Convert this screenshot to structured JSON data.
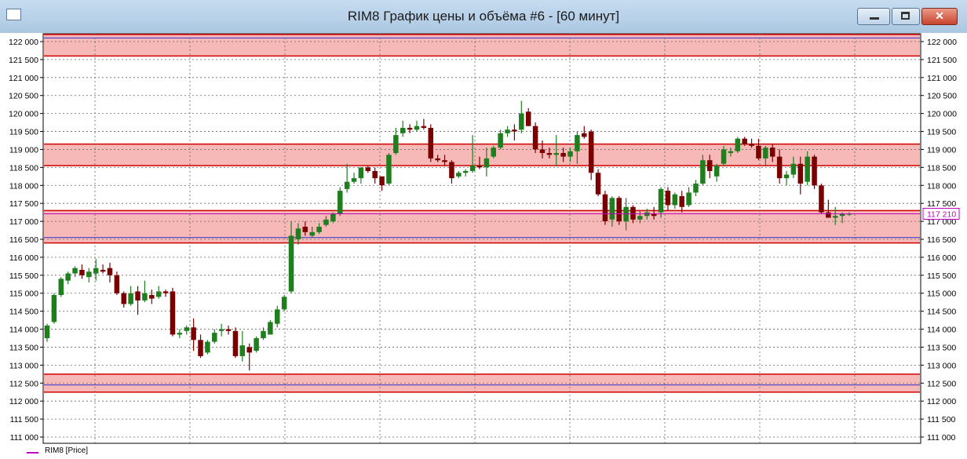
{
  "window": {
    "title": "RIM8 График цены и объёма #6 - [60 минут]",
    "buttons": {
      "minimize_glyph": "",
      "maximize_glyph": "",
      "close_glyph": "✕"
    }
  },
  "legend": {
    "series_label": "RIM8 [Price]"
  },
  "colors": {
    "bull": "#1f7f1f",
    "bear": "#7a0000",
    "zone_fill": "#f7b8b8",
    "zone_line": "#d00000",
    "blue_line": "#3030d0",
    "current_price": "#c000c0"
  },
  "chart_data": {
    "type": "candlestick",
    "title": "RIM8 График цены и объёма #6 - [60 минут]",
    "series_name": "RIM8 [Price]",
    "ylim": [
      111000,
      122200
    ],
    "y_ticks": [
      "122 000",
      "121 500",
      "121 000",
      "120 500",
      "120 000",
      "119 500",
      "119 000",
      "118 500",
      "118 000",
      "117 500",
      "117 000",
      "116 500",
      "116 000",
      "115 500",
      "115 000",
      "114 500",
      "114 000",
      "113 500",
      "113 000",
      "112 500",
      "112 000",
      "111 500",
      "111 000"
    ],
    "current_price_label": "117 210",
    "current_price": 117210,
    "grid": true,
    "zones": [
      {
        "low": 121600,
        "high": 122200,
        "blue": 122100
      },
      {
        "low": 118550,
        "high": 119150,
        "blue": null
      },
      {
        "low": 116400,
        "high": 117300,
        "blue": 116550
      },
      {
        "low": 112250,
        "high": 112750,
        "blue": 112450
      }
    ],
    "candles": [
      {
        "o": 113750,
        "h": 114150,
        "l": 113650,
        "c": 114100
      },
      {
        "o": 114200,
        "h": 115000,
        "l": 114150,
        "c": 114950
      },
      {
        "o": 114950,
        "h": 115450,
        "l": 114900,
        "c": 115400
      },
      {
        "o": 115350,
        "h": 115600,
        "l": 115250,
        "c": 115550
      },
      {
        "o": 115550,
        "h": 115750,
        "l": 115450,
        "c": 115700
      },
      {
        "o": 115650,
        "h": 115800,
        "l": 115400,
        "c": 115500
      },
      {
        "o": 115450,
        "h": 115700,
        "l": 115300,
        "c": 115600
      },
      {
        "o": 115550,
        "h": 115950,
        "l": 115350,
        "c": 115700
      },
      {
        "o": 115650,
        "h": 115800,
        "l": 115550,
        "c": 115600
      },
      {
        "o": 115700,
        "h": 115850,
        "l": 115300,
        "c": 115500
      },
      {
        "o": 115500,
        "h": 115600,
        "l": 114950,
        "c": 115000
      },
      {
        "o": 115000,
        "h": 115050,
        "l": 114600,
        "c": 114700
      },
      {
        "o": 114700,
        "h": 115200,
        "l": 114650,
        "c": 115000
      },
      {
        "o": 115050,
        "h": 115200,
        "l": 114400,
        "c": 114800
      },
      {
        "o": 114800,
        "h": 115350,
        "l": 114750,
        "c": 115000
      },
      {
        "o": 114950,
        "h": 115100,
        "l": 114700,
        "c": 114850
      },
      {
        "o": 114900,
        "h": 115200,
        "l": 114850,
        "c": 115050
      },
      {
        "o": 115050,
        "h": 115100,
        "l": 114900,
        "c": 115000
      },
      {
        "o": 115050,
        "h": 115150,
        "l": 113800,
        "c": 113850
      },
      {
        "o": 113850,
        "h": 114000,
        "l": 113750,
        "c": 113900
      },
      {
        "o": 113950,
        "h": 114100,
        "l": 113850,
        "c": 114050
      },
      {
        "o": 114050,
        "h": 114300,
        "l": 113400,
        "c": 113700
      },
      {
        "o": 113700,
        "h": 113850,
        "l": 113200,
        "c": 113250
      },
      {
        "o": 113350,
        "h": 113700,
        "l": 113300,
        "c": 113650
      },
      {
        "o": 113650,
        "h": 114000,
        "l": 113600,
        "c": 113900
      },
      {
        "o": 113950,
        "h": 114150,
        "l": 113800,
        "c": 114000
      },
      {
        "o": 114000,
        "h": 114100,
        "l": 113850,
        "c": 113950
      },
      {
        "o": 113950,
        "h": 114050,
        "l": 113200,
        "c": 113250
      },
      {
        "o": 113250,
        "h": 113950,
        "l": 113100,
        "c": 113550
      },
      {
        "o": 113500,
        "h": 113600,
        "l": 112850,
        "c": 113350
      },
      {
        "o": 113400,
        "h": 113800,
        "l": 113350,
        "c": 113750
      },
      {
        "o": 113750,
        "h": 114050,
        "l": 113700,
        "c": 113950
      },
      {
        "o": 113850,
        "h": 114250,
        "l": 113850,
        "c": 114200
      },
      {
        "o": 114150,
        "h": 114650,
        "l": 114050,
        "c": 114550
      },
      {
        "o": 114550,
        "h": 114950,
        "l": 114500,
        "c": 114900
      },
      {
        "o": 115050,
        "h": 117000,
        "l": 115000,
        "c": 116600
      },
      {
        "o": 116500,
        "h": 116950,
        "l": 116350,
        "c": 116800
      },
      {
        "o": 116850,
        "h": 117000,
        "l": 116600,
        "c": 116700
      },
      {
        "o": 116600,
        "h": 116850,
        "l": 116550,
        "c": 116700
      },
      {
        "o": 116700,
        "h": 116950,
        "l": 116650,
        "c": 116850
      },
      {
        "o": 116900,
        "h": 117150,
        "l": 116850,
        "c": 117050
      },
      {
        "o": 117000,
        "h": 117250,
        "l": 116950,
        "c": 117200
      },
      {
        "o": 117200,
        "h": 117950,
        "l": 117150,
        "c": 117850
      },
      {
        "o": 117900,
        "h": 118600,
        "l": 117800,
        "c": 118100
      },
      {
        "o": 118100,
        "h": 118350,
        "l": 118050,
        "c": 118200
      },
      {
        "o": 118200,
        "h": 118400,
        "l": 118050,
        "c": 118500
      },
      {
        "o": 118500,
        "h": 118550,
        "l": 118350,
        "c": 118400
      },
      {
        "o": 118400,
        "h": 118500,
        "l": 118050,
        "c": 118200
      },
      {
        "o": 118250,
        "h": 118250,
        "l": 117850,
        "c": 118000
      },
      {
        "o": 118050,
        "h": 118900,
        "l": 118000,
        "c": 118850
      },
      {
        "o": 118900,
        "h": 119600,
        "l": 118850,
        "c": 119400
      },
      {
        "o": 119450,
        "h": 119800,
        "l": 119350,
        "c": 119600
      },
      {
        "o": 119600,
        "h": 119700,
        "l": 119450,
        "c": 119550
      },
      {
        "o": 119550,
        "h": 119800,
        "l": 119500,
        "c": 119650
      },
      {
        "o": 119650,
        "h": 119850,
        "l": 119550,
        "c": 119600
      },
      {
        "o": 119600,
        "h": 119700,
        "l": 118650,
        "c": 118750
      },
      {
        "o": 118750,
        "h": 118850,
        "l": 118650,
        "c": 118700
      },
      {
        "o": 118700,
        "h": 118850,
        "l": 118550,
        "c": 118650
      },
      {
        "o": 118650,
        "h": 118700,
        "l": 118050,
        "c": 118200
      },
      {
        "o": 118250,
        "h": 118400,
        "l": 118200,
        "c": 118350
      },
      {
        "o": 118350,
        "h": 118450,
        "l": 118250,
        "c": 118400
      },
      {
        "o": 118400,
        "h": 119400,
        "l": 118350,
        "c": 118550
      },
      {
        "o": 118550,
        "h": 118800,
        "l": 118450,
        "c": 118500
      },
      {
        "o": 118500,
        "h": 119050,
        "l": 118250,
        "c": 118750
      },
      {
        "o": 118800,
        "h": 119100,
        "l": 118750,
        "c": 119050
      },
      {
        "o": 119050,
        "h": 119550,
        "l": 119000,
        "c": 119450
      },
      {
        "o": 119450,
        "h": 119650,
        "l": 119350,
        "c": 119550
      },
      {
        "o": 119550,
        "h": 119700,
        "l": 119250,
        "c": 119500
      },
      {
        "o": 119550,
        "h": 120350,
        "l": 119450,
        "c": 120000
      },
      {
        "o": 120050,
        "h": 120150,
        "l": 119650,
        "c": 119650
      },
      {
        "o": 119650,
        "h": 119750,
        "l": 118900,
        "c": 119000
      },
      {
        "o": 119000,
        "h": 119250,
        "l": 118750,
        "c": 118900
      },
      {
        "o": 118900,
        "h": 119050,
        "l": 118750,
        "c": 118850
      },
      {
        "o": 118850,
        "h": 119400,
        "l": 118550,
        "c": 118900
      },
      {
        "o": 118900,
        "h": 119050,
        "l": 118650,
        "c": 118800
      },
      {
        "o": 118800,
        "h": 119050,
        "l": 118650,
        "c": 118950
      },
      {
        "o": 118950,
        "h": 119500,
        "l": 118600,
        "c": 119400
      },
      {
        "o": 119450,
        "h": 119650,
        "l": 119300,
        "c": 119350
      },
      {
        "o": 119500,
        "h": 119550,
        "l": 118150,
        "c": 118350
      },
      {
        "o": 118350,
        "h": 118450,
        "l": 117700,
        "c": 117750
      },
      {
        "o": 117750,
        "h": 117850,
        "l": 116900,
        "c": 117000
      },
      {
        "o": 117050,
        "h": 117700,
        "l": 116850,
        "c": 117650
      },
      {
        "o": 117650,
        "h": 117700,
        "l": 116900,
        "c": 117000
      },
      {
        "o": 117000,
        "h": 117650,
        "l": 116750,
        "c": 117400
      },
      {
        "o": 117400,
        "h": 117450,
        "l": 116950,
        "c": 117050
      },
      {
        "o": 117050,
        "h": 117300,
        "l": 116950,
        "c": 117150
      },
      {
        "o": 117150,
        "h": 117350,
        "l": 117050,
        "c": 117250
      },
      {
        "o": 117200,
        "h": 117400,
        "l": 117050,
        "c": 117150
      },
      {
        "o": 117250,
        "h": 117950,
        "l": 117100,
        "c": 117900
      },
      {
        "o": 117850,
        "h": 117950,
        "l": 117300,
        "c": 117450
      },
      {
        "o": 117450,
        "h": 117800,
        "l": 117350,
        "c": 117750
      },
      {
        "o": 117700,
        "h": 117850,
        "l": 117250,
        "c": 117400
      },
      {
        "o": 117450,
        "h": 117950,
        "l": 117400,
        "c": 117800
      },
      {
        "o": 117800,
        "h": 118150,
        "l": 117700,
        "c": 118050
      },
      {
        "o": 118050,
        "h": 118850,
        "l": 118000,
        "c": 118700
      },
      {
        "o": 118700,
        "h": 118850,
        "l": 118200,
        "c": 118400
      },
      {
        "o": 118250,
        "h": 118600,
        "l": 118100,
        "c": 118550
      },
      {
        "o": 118600,
        "h": 119100,
        "l": 118550,
        "c": 119000
      },
      {
        "o": 118900,
        "h": 119050,
        "l": 118800,
        "c": 118950
      },
      {
        "o": 118950,
        "h": 119350,
        "l": 118900,
        "c": 119300
      },
      {
        "o": 119300,
        "h": 119350,
        "l": 119100,
        "c": 119150
      },
      {
        "o": 119150,
        "h": 119300,
        "l": 119050,
        "c": 119100
      },
      {
        "o": 119100,
        "h": 119300,
        "l": 118700,
        "c": 118750
      },
      {
        "o": 118750,
        "h": 119100,
        "l": 118550,
        "c": 119050
      },
      {
        "o": 119050,
        "h": 119150,
        "l": 118650,
        "c": 118800
      },
      {
        "o": 118800,
        "h": 119000,
        "l": 118050,
        "c": 118200
      },
      {
        "o": 118200,
        "h": 118400,
        "l": 118000,
        "c": 118300
      },
      {
        "o": 118300,
        "h": 118800,
        "l": 118200,
        "c": 118600
      },
      {
        "o": 118600,
        "h": 118800,
        "l": 117750,
        "c": 118050
      },
      {
        "o": 118100,
        "h": 118950,
        "l": 118000,
        "c": 118800
      },
      {
        "o": 118800,
        "h": 118850,
        "l": 117900,
        "c": 118000
      },
      {
        "o": 118000,
        "h": 118050,
        "l": 117200,
        "c": 117250
      },
      {
        "o": 117250,
        "h": 117600,
        "l": 117150,
        "c": 117100
      },
      {
        "o": 117100,
        "h": 117400,
        "l": 116900,
        "c": 117150
      },
      {
        "o": 117150,
        "h": 117250,
        "l": 116950,
        "c": 117200
      },
      {
        "o": 117200,
        "h": 117250,
        "l": 117150,
        "c": 117210
      }
    ]
  }
}
